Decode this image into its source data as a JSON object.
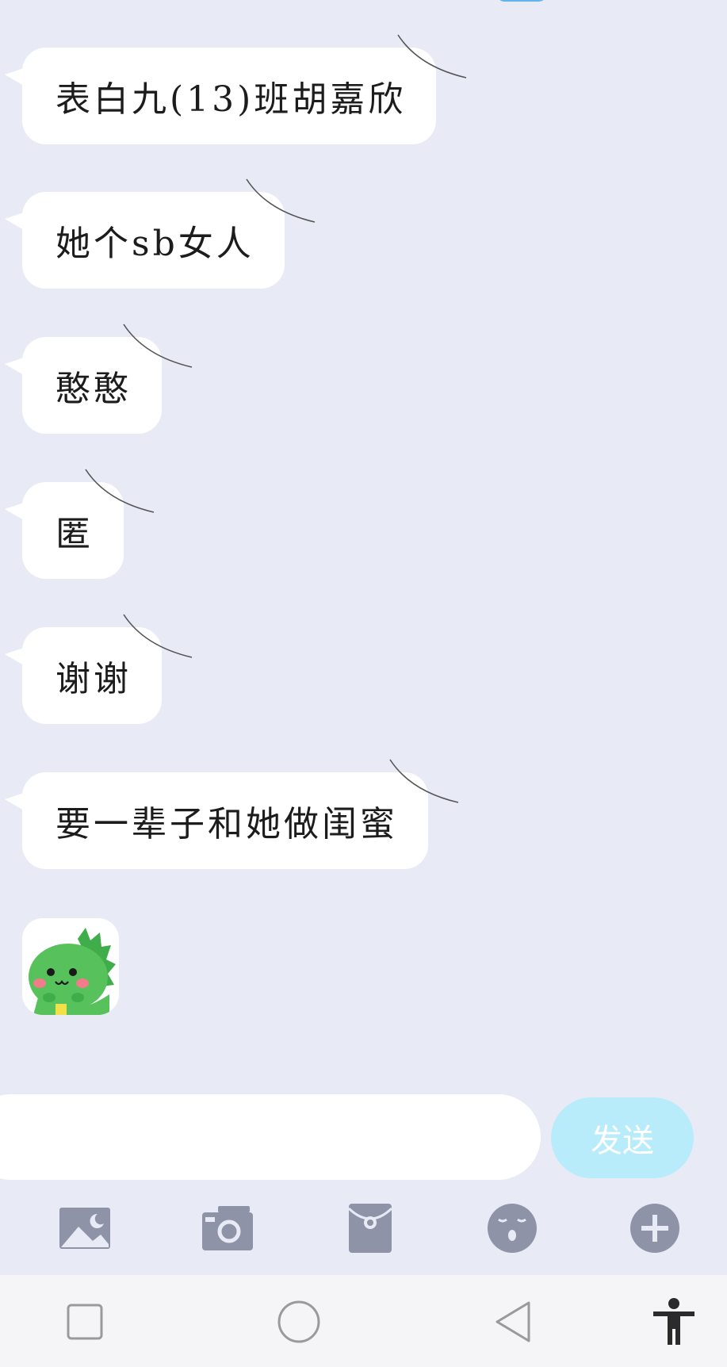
{
  "messages": [
    {
      "text": "表白九(13)班胡嘉欣"
    },
    {
      "text": "她个sb女人"
    },
    {
      "text": "憨憨"
    },
    {
      "text": "匿"
    },
    {
      "text": "谢谢"
    },
    {
      "text": "要一辈子和她做闺蜜"
    }
  ],
  "sticker": {
    "icon": "green-dinosaur-sticker"
  },
  "composer": {
    "placeholder": "",
    "send_label": "发送"
  },
  "toolbar": {
    "items": [
      {
        "icon": "image-icon"
      },
      {
        "icon": "camera-icon"
      },
      {
        "icon": "red-packet-icon"
      },
      {
        "icon": "emoji-icon"
      },
      {
        "icon": "plus-icon"
      }
    ]
  },
  "navbar": {
    "items": [
      {
        "icon": "recent-apps-icon"
      },
      {
        "icon": "home-icon"
      },
      {
        "icon": "back-icon"
      },
      {
        "icon": "accessibility-icon"
      }
    ]
  },
  "colors": {
    "background": "#e8ebf6",
    "bubble": "#ffffff",
    "send_button": "#b8ecfa",
    "toolbar_icon": "#8e93a8"
  }
}
